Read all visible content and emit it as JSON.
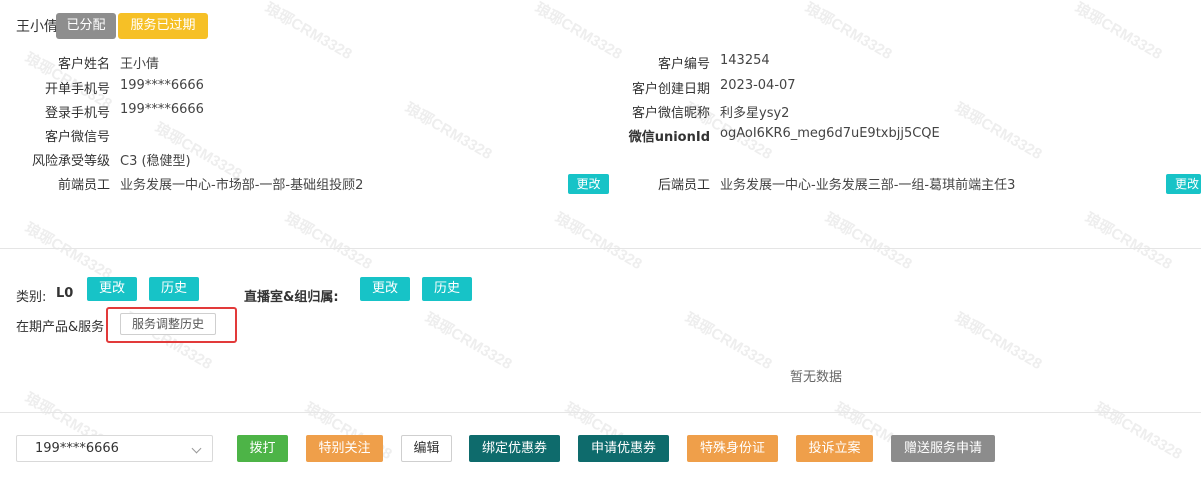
{
  "header": {
    "name": "王小倩",
    "tag_assigned": "已分配",
    "tag_expired": "服务已过期"
  },
  "info": {
    "customer_name_label": "客户姓名",
    "customer_name": "王小倩",
    "order_phone_label": "开单手机号",
    "order_phone": "199****6666",
    "login_phone_label": "登录手机号",
    "login_phone": "199****6666",
    "wechat_id_label": "客户微信号",
    "wechat_id": "",
    "risk_label": "风险承受等级",
    "risk": "C3 (稳健型)",
    "front_staff_label": "前端员工",
    "front_staff": "业务发展一中心-市场部-一部-基础组投顾2",
    "change": "更改",
    "customer_no_label": "客户编号",
    "customer_no": "143254",
    "create_date_label": "客户创建日期",
    "create_date": "2023-04-07",
    "wechat_nick_label": "客户微信昵称",
    "wechat_nick": "利多星ysy2",
    "unionid_label": "微信unionId",
    "unionid": "ogAoI6KR6_meg6d7uE9txbjj5CQE",
    "back_staff_label": "后端员工",
    "back_staff": "业务发展一中心-业务发展三部-一组-葛琪前端主任3",
    "change2": "更改"
  },
  "category": {
    "label": "类别:",
    "value": "L0",
    "change": "更改",
    "history": "历史",
    "live_label": "直播室&组归属:",
    "live_change": "更改",
    "live_history": "历史"
  },
  "products": {
    "label": "在期产品&服务",
    "adjust_history": "服务调整历史",
    "empty": "暂无数据"
  },
  "actions": {
    "phone_select": "199****6666",
    "dial": "拨打",
    "special_attention": "特别关注",
    "edit": "编辑",
    "bind_coupon": "绑定优惠券",
    "apply_coupon": "申请优惠券",
    "special_id": "特殊身份证",
    "complaint": "投诉立案",
    "gift_service": "赠送服务申请"
  },
  "watermark": "琅琊CRM3328"
}
